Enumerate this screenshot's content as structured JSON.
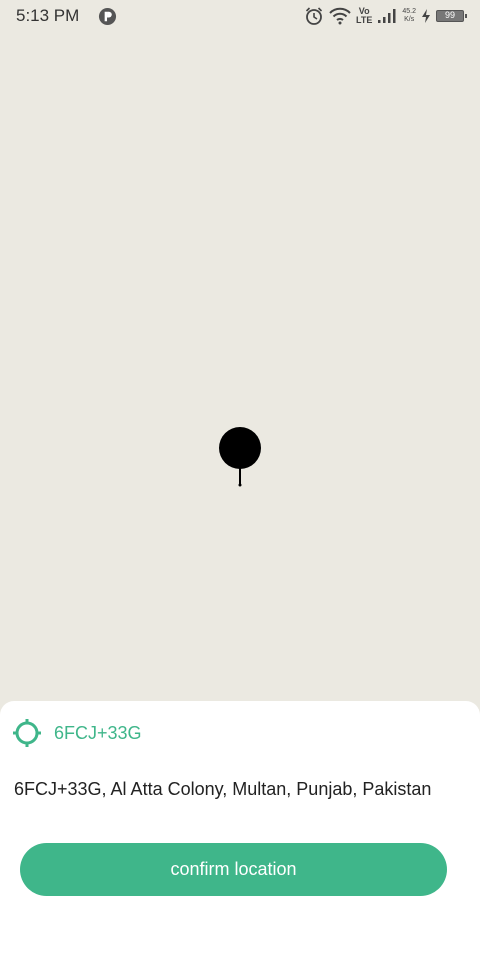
{
  "status_bar": {
    "time": "5:13 PM",
    "volte_top": "Vo",
    "volte_bottom": "LTE",
    "net_speed_value": "45.2",
    "net_speed_unit": "K/s",
    "battery_level": "99",
    "icons": [
      "p-app-icon",
      "alarm-icon",
      "wifi-icon",
      "volte-icon",
      "signal-icon",
      "charging-icon",
      "battery-icon"
    ]
  },
  "map": {
    "background_color": "#ebe9e1",
    "marker": "map-pin-icon"
  },
  "location_sheet": {
    "place_code": "6FCJ+33G",
    "address": "6FCJ+33G, Al Atta Colony, Multan, Punjab, Pakistan",
    "confirm_label": "confirm location",
    "accent_color": "#3fb68a",
    "locate_icon": "my-location-icon"
  }
}
